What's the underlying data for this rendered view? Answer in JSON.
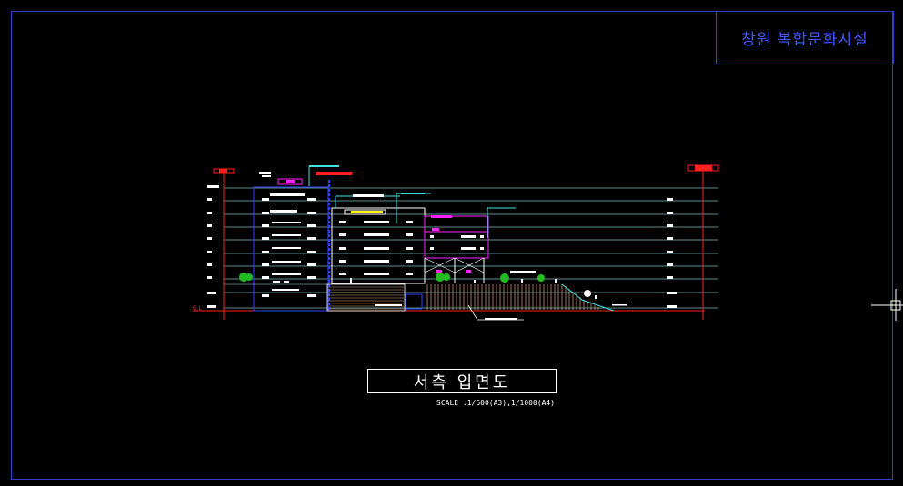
{
  "title_block": {
    "project_name": "창원 복합문화시설"
  },
  "drawing": {
    "sheet_title": "서측 입면도",
    "scale_note": "SCALE :1/600(A3),1/1000(A4)",
    "ground_level_label": "G.L"
  },
  "colors": {
    "background": "#000000",
    "frame": "#2f3ccf",
    "title_text": "#3b59ff",
    "level_line": "#9fd4d4",
    "grid_red": "#ff2020",
    "cyan": "#3fe0e0",
    "magenta": "#ff22ff",
    "yellow": "#ffff00",
    "green_tree": "#22bb22",
    "tan_hatch": "#d8a878"
  }
}
